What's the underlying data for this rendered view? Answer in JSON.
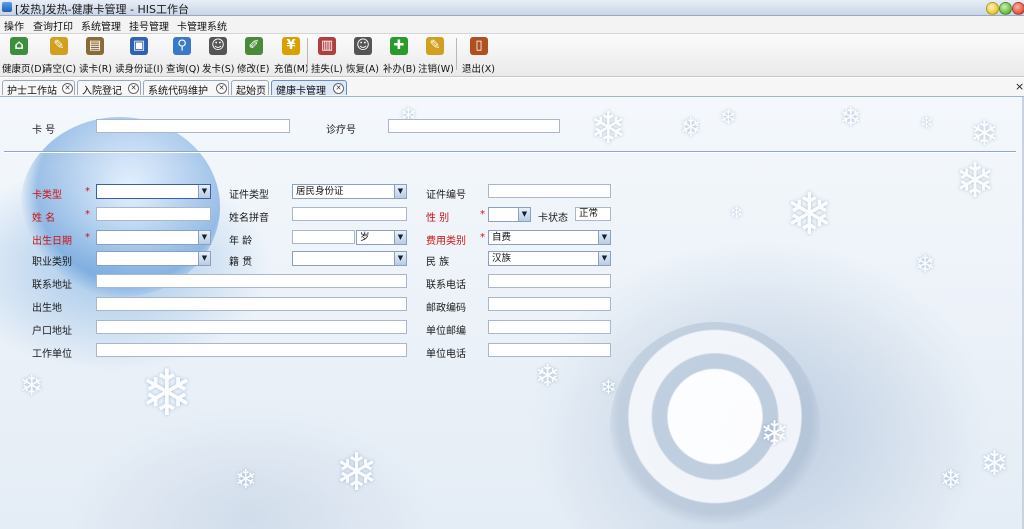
{
  "window": {
    "title": "[发热]发热-健康卡管理 - HIS工作台"
  },
  "menu": {
    "items": [
      "操作",
      "查询打印",
      "系统管理",
      "挂号管理",
      "卡管理系统"
    ]
  },
  "toolbar": {
    "buttons": [
      {
        "label": "健康页(D)",
        "icon": "home-icon",
        "color": "#3d8f3d"
      },
      {
        "label": "清空(C)",
        "icon": "broom-icon",
        "color": "#d2a020"
      },
      {
        "label": "读卡(R)",
        "icon": "card-reader-icon",
        "color": "#8a6a3a"
      },
      {
        "label": "读身份证(I)",
        "icon": "id-card-icon",
        "color": "#2f62b0"
      },
      {
        "label": "查询(Q)",
        "icon": "search-icon",
        "color": "#3a78c8"
      },
      {
        "label": "发卡(S)",
        "icon": "user-icon",
        "color": "#555555"
      },
      {
        "label": "修改(E)",
        "icon": "edit-icon",
        "color": "#4b8a3a"
      },
      {
        "label": "充值(M)",
        "icon": "yen-icon",
        "color": "#d8a000"
      },
      {
        "label": "挂失(L)",
        "icon": "report-loss-icon",
        "color": "#b04040"
      },
      {
        "label": "恢复(A)",
        "icon": "user-restore-icon",
        "color": "#555555"
      },
      {
        "label": "补办(B)",
        "icon": "plus-cross-icon",
        "color": "#2a9a2a"
      },
      {
        "label": "注销(W)",
        "icon": "broom-icon",
        "color": "#d2a020"
      },
      {
        "label": "退出(X)",
        "icon": "exit-door-icon",
        "color": "#b05020"
      }
    ]
  },
  "tabs": [
    {
      "label": "护士工作站",
      "active": false
    },
    {
      "label": "入院登记",
      "active": false
    },
    {
      "label": "系统代码维护",
      "active": false
    },
    {
      "label": "起始页",
      "active": false
    },
    {
      "label": "健康卡管理",
      "active": true
    }
  ],
  "panel": {
    "close_glyph": "×"
  },
  "search": {
    "card_no_label": "卡 号",
    "card_no_value": "",
    "visit_no_label": "诊疗号",
    "visit_no_value": ""
  },
  "form": {
    "card_type": {
      "label": "卡类型",
      "value": ""
    },
    "id_type": {
      "label": "证件类型",
      "value": "居民身份证"
    },
    "id_no": {
      "label": "证件编号",
      "value": ""
    },
    "name": {
      "label": "姓 名",
      "value": ""
    },
    "name_pinyin": {
      "label": "姓名拼音",
      "value": ""
    },
    "gender": {
      "label": "性 别",
      "value": ""
    },
    "card_status": {
      "label": "卡状态",
      "value": "正常"
    },
    "birth_date": {
      "label": "出生日期",
      "value": ""
    },
    "age": {
      "label": "年 龄",
      "value": "",
      "unit": "岁"
    },
    "fee_category": {
      "label": "费用类别",
      "value": "自费"
    },
    "occupation": {
      "label": "职业类别",
      "value": ""
    },
    "native_place": {
      "label": "籍 贯",
      "value": ""
    },
    "ethnicity": {
      "label": "民 族",
      "value": "汉族"
    },
    "contact_address": {
      "label": "联系地址",
      "value": ""
    },
    "contact_phone": {
      "label": "联系电话",
      "value": ""
    },
    "birthplace": {
      "label": "出生地",
      "value": ""
    },
    "postal_code": {
      "label": "邮政编码",
      "value": ""
    },
    "household_address": {
      "label": "户口地址",
      "value": ""
    },
    "work_postal_code": {
      "label": "单位邮编",
      "value": ""
    },
    "work_unit": {
      "label": "工作单位",
      "value": ""
    },
    "work_phone": {
      "label": "单位电话",
      "value": ""
    }
  },
  "required_mark": "*",
  "dropdown_arrow": "▼"
}
